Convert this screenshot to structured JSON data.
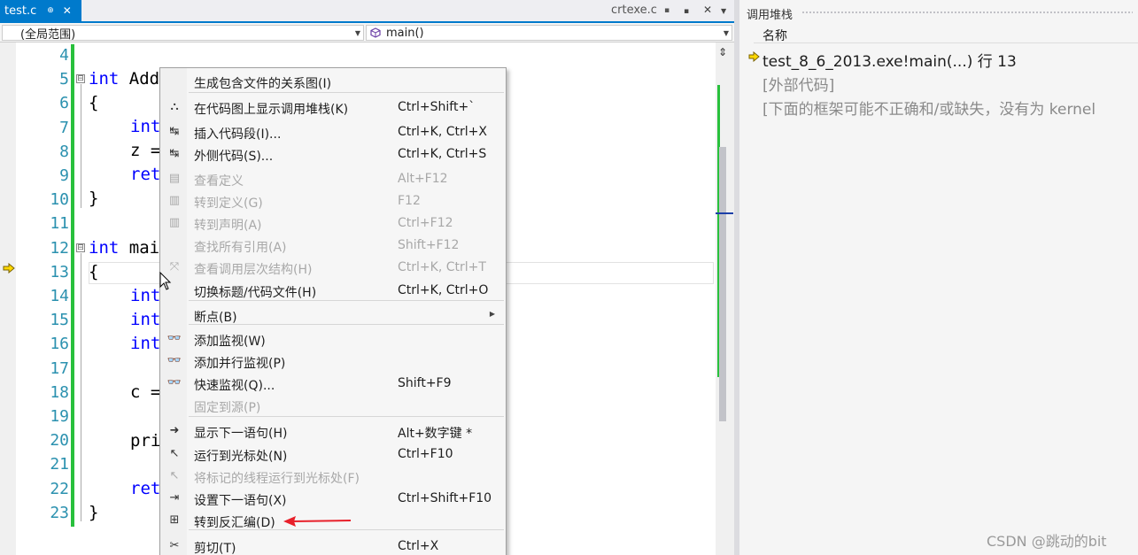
{
  "tabs": {
    "active": {
      "label": "test.c",
      "pin": "⊕",
      "close": "✕"
    },
    "inactive": {
      "label": "crtexe.c",
      "pin": "▪"
    },
    "controls": {
      "dropdown": "▪",
      "close": "✕",
      "menu": "▼"
    }
  },
  "navbar": {
    "scope": "(全局范围)",
    "function": "main()",
    "dropdown_arrow": "▼"
  },
  "editor": {
    "line_numbers": [
      "4",
      "5",
      "6",
      "7",
      "8",
      "9",
      "10",
      "11",
      "12",
      "13",
      "14",
      "15",
      "16",
      "17",
      "18",
      "19",
      "20",
      "21",
      "22",
      "23"
    ],
    "code": {
      "l5_kw": "int",
      "l5_rest": " Add",
      "l6": "{",
      "l7_kw": "int",
      "l8": "z =",
      "l9": "ret",
      "l10": "}",
      "l12_kw": "int",
      "l12_rest": " mai",
      "l13": "{",
      "l14_kw": "int",
      "l15_kw": "int",
      "l16_kw": "int",
      "l18": "c =",
      "l20": "pri",
      "l22": "ret",
      "l23": "}"
    },
    "fold_symbol": "⊟"
  },
  "call_stack": {
    "title": "调用堆栈",
    "column_header": "名称",
    "rows": [
      {
        "text": "test_8_6_2013.exe!main(...) 行 13",
        "color": "#1e1e1e"
      },
      {
        "text": "[外部代码]",
        "color": "#8a8a8a"
      },
      {
        "text": "[下面的框架可能不正确和/或缺失，没有为 kernel",
        "color": "#8a8a8a"
      }
    ]
  },
  "menu": {
    "items": [
      {
        "icon": "",
        "icon_name": "none",
        "label": "生成包含文件的关系图(I)",
        "shortcut": "",
        "disabled": false
      },
      {
        "icon": "⛬",
        "icon_name": "call-stack-map-icon",
        "label": "在代码图上显示调用堆栈(K)",
        "shortcut": "Ctrl+Shift+`",
        "disabled": false
      },
      {
        "icon": "↹",
        "icon_name": "insert-snippet-icon",
        "label": "插入代码段(I)...",
        "shortcut": "Ctrl+K, Ctrl+X",
        "disabled": false
      },
      {
        "icon": "↹",
        "icon_name": "surround-with-icon",
        "label": "外侧代码(S)...",
        "shortcut": "Ctrl+K, Ctrl+S",
        "disabled": false
      },
      {
        "icon": "▤",
        "icon_name": "peek-definition-icon",
        "label": "查看定义",
        "shortcut": "Alt+F12",
        "disabled": true
      },
      {
        "icon": "▥",
        "icon_name": "goto-definition-icon",
        "label": "转到定义(G)",
        "shortcut": "F12",
        "disabled": true
      },
      {
        "icon": "▥",
        "icon_name": "goto-declaration-icon",
        "label": "转到声明(A)",
        "shortcut": "Ctrl+F12",
        "disabled": true
      },
      {
        "icon": "",
        "icon_name": "none",
        "label": "查找所有引用(A)",
        "shortcut": "Shift+F12",
        "disabled": true
      },
      {
        "icon": "⤧",
        "icon_name": "call-hierarchy-icon",
        "label": "查看调用层次结构(H)",
        "shortcut": "Ctrl+K, Ctrl+T",
        "disabled": true
      },
      {
        "icon": "",
        "icon_name": "none",
        "label": "切换标题/代码文件(H)",
        "shortcut": "Ctrl+K, Ctrl+O",
        "disabled": false
      },
      {
        "icon": "",
        "icon_name": "none",
        "label": "断点(B)",
        "shortcut": "",
        "disabled": false,
        "submenu": "▶"
      },
      {
        "icon": "👓",
        "icon_name": "watch-glasses-icon",
        "label": "添加监视(W)",
        "shortcut": "",
        "disabled": false
      },
      {
        "icon": "👓",
        "icon_name": "parallel-watch-glasses-icon",
        "label": "添加并行监视(P)",
        "shortcut": "",
        "disabled": false
      },
      {
        "icon": "👓",
        "icon_name": "quick-watch-glasses-icon",
        "label": "快速监视(Q)...",
        "shortcut": "Shift+F9",
        "disabled": false
      },
      {
        "icon": "",
        "icon_name": "none",
        "label": "固定到源(P)",
        "shortcut": "",
        "disabled": true
      },
      {
        "icon": "➜",
        "icon_name": "show-next-statement-icon",
        "label": "显示下一语句(H)",
        "shortcut": "Alt+数字键 *",
        "disabled": false
      },
      {
        "icon": "↖",
        "icon_name": "run-to-cursor-icon",
        "label": "运行到光标处(N)",
        "shortcut": "Ctrl+F10",
        "disabled": false
      },
      {
        "icon": "↖",
        "icon_name": "run-flagged-threads-icon",
        "label": "将标记的线程运行到光标处(F)",
        "shortcut": "",
        "disabled": true
      },
      {
        "icon": "⇥",
        "icon_name": "set-next-statement-icon",
        "label": "设置下一语句(X)",
        "shortcut": "Ctrl+Shift+F10",
        "disabled": false
      },
      {
        "icon": "⊞",
        "icon_name": "goto-disassembly-icon",
        "label": "转到反汇编(D)",
        "shortcut": "",
        "disabled": false
      },
      {
        "icon": "✂",
        "icon_name": "cut-scissors-icon",
        "label": "剪切(T)",
        "shortcut": "Ctrl+X",
        "disabled": false
      }
    ]
  },
  "watermark": "CSDN @跳动的bit",
  "colors": {
    "accent": "#007acc",
    "keyword": "#0000ff",
    "line_number": "#2b91af",
    "change_bar": "#28c03c",
    "annotation_arrow": "#e8202a"
  }
}
